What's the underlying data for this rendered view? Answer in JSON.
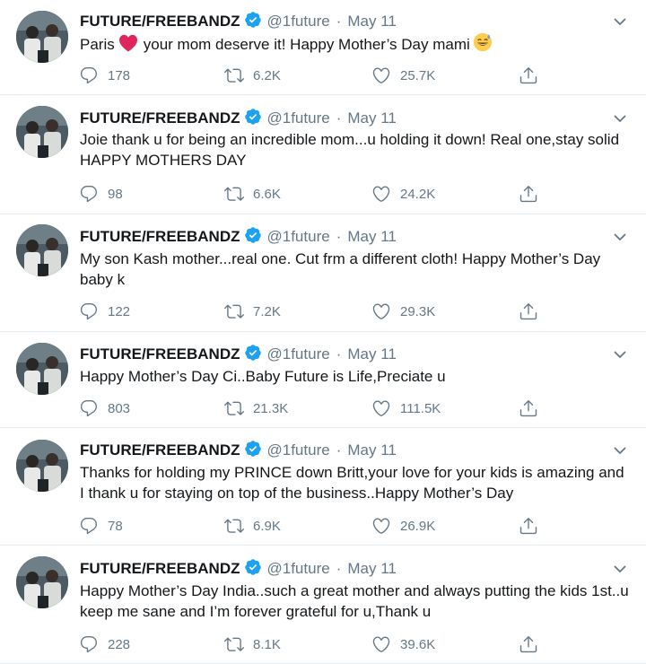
{
  "colors": {
    "text": "#14171a",
    "muted": "#657786",
    "verified": "#1da1f2",
    "divider": "#e6ecf0",
    "heart": "#e0245e"
  },
  "tweets": [
    {
      "name": "FUTURE/FREEBANDZ",
      "handle": "@1future",
      "date": "May 11",
      "text_before": "Paris",
      "text_icon": "red-heart-emoji",
      "text_after": "your mom deserve it! Happy Mother’s Day mami",
      "text_end_icon": "sweat-smile-emoji",
      "replies": "178",
      "retweets": "6.2K",
      "likes": "25.7K"
    },
    {
      "name": "FUTURE/FREEBANDZ",
      "handle": "@1future",
      "date": "May 11",
      "text": "Joie thank u for being an incredible mom...u holding it down! Real one,stay solid HAPPY MOTHERS DAY",
      "replies": "98",
      "retweets": "6.6K",
      "likes": "24.2K"
    },
    {
      "name": "FUTURE/FREEBANDZ",
      "handle": "@1future",
      "date": "May 11",
      "text": "My son Kash mother...real one. Cut frm a different cloth! Happy Mother’s Day baby k",
      "replies": "122",
      "retweets": "7.2K",
      "likes": "29.3K"
    },
    {
      "name": "FUTURE/FREEBANDZ",
      "handle": "@1future",
      "date": "May 11",
      "text": "Happy Mother’s Day Ci..Baby Future is Life,Preciate u",
      "replies": "803",
      "retweets": "21.3K",
      "likes": "111.5K"
    },
    {
      "name": "FUTURE/FREEBANDZ",
      "handle": "@1future",
      "date": "May 11",
      "text": "Thanks for holding my PRINCE down Britt,your love for your kids is amazing and I thank u for staying on top of the business..Happy Mother’s Day",
      "replies": "78",
      "retweets": "6.9K",
      "likes": "26.9K"
    },
    {
      "name": "FUTURE/FREEBANDZ",
      "handle": "@1future",
      "date": "May 11",
      "text": "Happy Mother’s Day India..such a great mother and always putting the kids 1st..u keep me sane and I’m forever grateful for u,Thank u",
      "replies": "228",
      "retweets": "8.1K",
      "likes": "39.6K"
    }
  ]
}
